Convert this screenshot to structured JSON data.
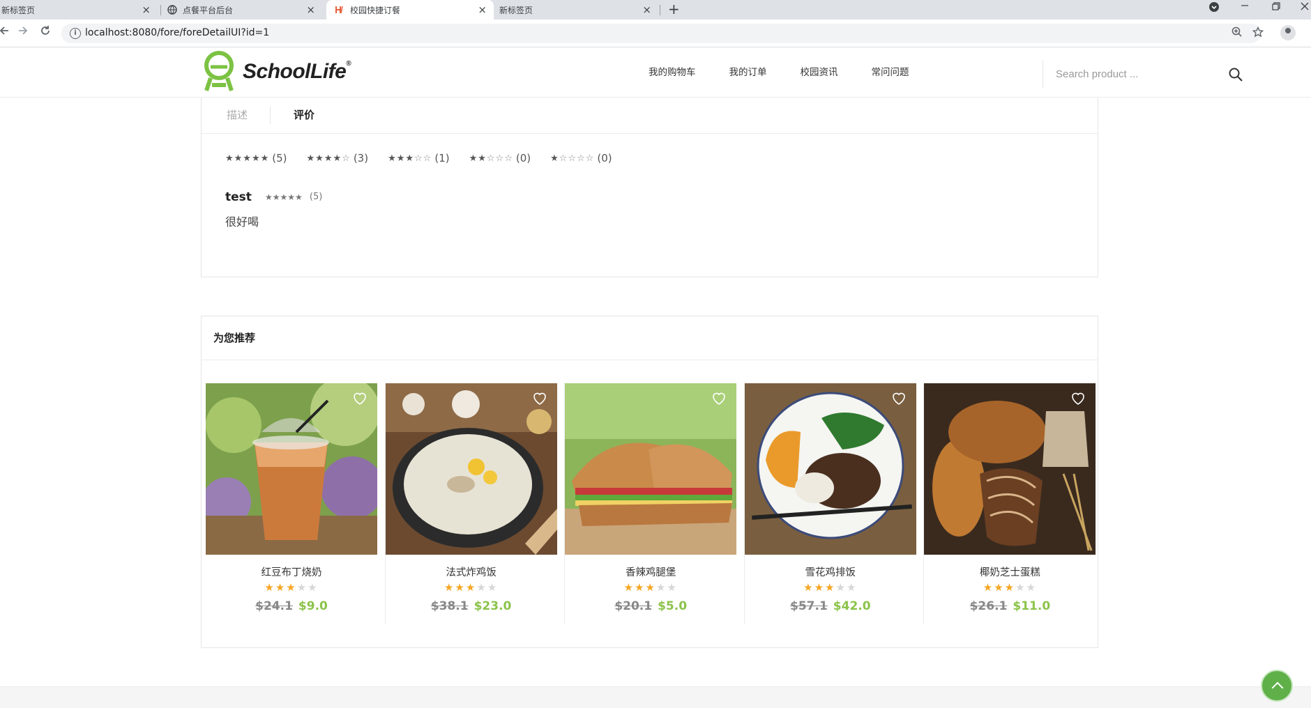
{
  "browser": {
    "tabs": [
      {
        "title": "新标签页",
        "active": false
      },
      {
        "title": "点餐平台后台",
        "active": false
      },
      {
        "title": "校园快捷订餐",
        "active": true
      },
      {
        "title": "新标签页",
        "active": false
      }
    ],
    "close_glyph": "×",
    "newtab_glyph": "+",
    "url": "localhost:8080/fore/foreDetailUI?id=1"
  },
  "header": {
    "logo_text": "SchoolLife",
    "nav": [
      "我的购物车",
      "我的订单",
      "校园资讯",
      "常问问题"
    ],
    "search_placeholder": "Search product ..."
  },
  "detail_tabs": {
    "description": "描述",
    "reviews": "评价"
  },
  "rating_filters": [
    {
      "stars": 5,
      "count": "(5)"
    },
    {
      "stars": 4,
      "count": "(3)"
    },
    {
      "stars": 3,
      "count": "(1)"
    },
    {
      "stars": 2,
      "count": "(0)"
    },
    {
      "stars": 1,
      "count": "(0)"
    }
  ],
  "review": {
    "user": "test",
    "stars": 5,
    "count": "(5)",
    "text": "很好喝"
  },
  "recommend": {
    "title": "为您推荐",
    "products": [
      {
        "name": "红豆布丁烧奶",
        "rating": 3,
        "old_price": "$24.1",
        "price": "$9.0",
        "image": "iced-milk-tea"
      },
      {
        "name": "法式炸鸡饭",
        "rating": 3,
        "old_price": "$38.1",
        "price": "$23.0",
        "image": "cream-soup"
      },
      {
        "name": "香辣鸡腿堡",
        "rating": 3,
        "old_price": "$20.1",
        "price": "$5.0",
        "image": "sandwich"
      },
      {
        "name": "雪花鸡排饭",
        "rating": 3,
        "old_price": "$57.1",
        "price": "$42.0",
        "image": "chicken-rice-plate"
      },
      {
        "name": "椰奶芝士蛋糕",
        "rating": 3,
        "old_price": "$26.1",
        "price": "$11.0",
        "image": "bread-loaves"
      }
    ]
  },
  "colors": {
    "accent_green": "#8bc34a",
    "star_gold": "#f5a623",
    "back_to_top": "#5fb048"
  },
  "icons": [
    "info-icon",
    "zoom-icon",
    "bookmark-star-icon",
    "profile-icon",
    "search-icon",
    "heart-icon",
    "arrow-up-icon"
  ]
}
